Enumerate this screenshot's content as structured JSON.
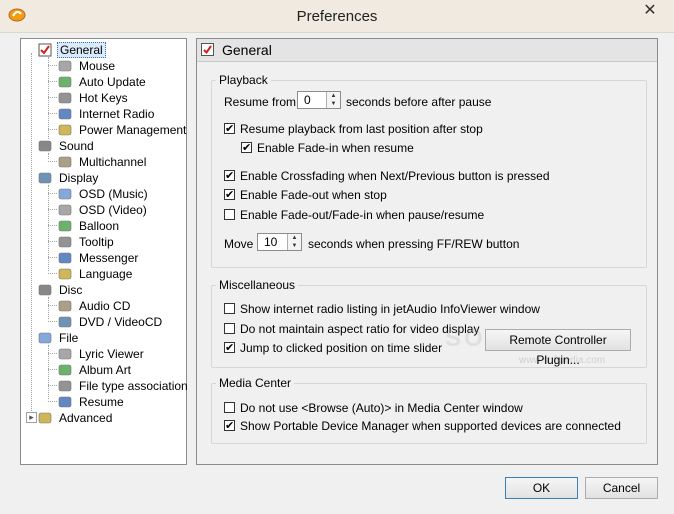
{
  "window": {
    "title": "Preferences",
    "close_symbol": "✕"
  },
  "tree": {
    "items": [
      {
        "label": "General",
        "level": 0,
        "icon": "general-check-icon",
        "selected": true
      },
      {
        "label": "Mouse",
        "level": 1,
        "icon": "mouse-icon"
      },
      {
        "label": "Auto Update",
        "level": 1,
        "icon": "update-icon"
      },
      {
        "label": "Hot Keys",
        "level": 1,
        "icon": "keyboard-icon"
      },
      {
        "label": "Internet Radio",
        "level": 1,
        "icon": "radio-icon"
      },
      {
        "label": "Power Management",
        "level": 1,
        "icon": "power-icon"
      },
      {
        "label": "Sound",
        "level": 0,
        "icon": "speaker-icon"
      },
      {
        "label": "Multichannel",
        "level": 1,
        "icon": "multichannel-icon"
      },
      {
        "label": "Display",
        "level": 0,
        "icon": "monitor-icon"
      },
      {
        "label": "OSD (Music)",
        "level": 1,
        "icon": "osd-music-icon"
      },
      {
        "label": "OSD (Video)",
        "level": 1,
        "icon": "osd-video-icon"
      },
      {
        "label": "Balloon",
        "level": 1,
        "icon": "balloon-icon"
      },
      {
        "label": "Tooltip",
        "level": 1,
        "icon": "tooltip-icon"
      },
      {
        "label": "Messenger",
        "level": 1,
        "icon": "messenger-icon"
      },
      {
        "label": "Language",
        "level": 1,
        "icon": "globe-icon"
      },
      {
        "label": "Disc",
        "level": 0,
        "icon": "disc-icon"
      },
      {
        "label": "Audio CD",
        "level": 1,
        "icon": "cd-icon"
      },
      {
        "label": "DVD / VideoCD",
        "level": 1,
        "icon": "dvd-icon"
      },
      {
        "label": "File",
        "level": 0,
        "icon": "file-icon"
      },
      {
        "label": "Lyric Viewer",
        "level": 1,
        "icon": "lyric-icon"
      },
      {
        "label": "Album Art",
        "level": 1,
        "icon": "album-art-icon"
      },
      {
        "label": "File type association",
        "level": 1,
        "icon": "file-type-icon"
      },
      {
        "label": "Resume",
        "level": 1,
        "icon": "resume-icon"
      },
      {
        "label": "Advanced",
        "level": 0,
        "icon": "advanced-icon",
        "collapsed": true
      }
    ]
  },
  "panel": {
    "title": "General",
    "playback": {
      "legend": "Playback",
      "resume_from_label": "Resume from",
      "resume_from_value": "0",
      "resume_from_suffix": "seconds before after pause",
      "resume_last_pos": {
        "label": "Resume playback from last position after stop",
        "checked": true
      },
      "fade_in_resume": {
        "label": "Enable Fade-in when resume",
        "checked": true
      },
      "crossfading": {
        "label": "Enable Crossfading when Next/Previous button is pressed",
        "checked": true
      },
      "fade_out_stop": {
        "label": "Enable Fade-out when stop",
        "checked": true
      },
      "fade_pause": {
        "label": "Enable Fade-out/Fade-in when pause/resume",
        "checked": false
      },
      "move_label": "Move",
      "move_value": "10",
      "move_suffix": "seconds when pressing FF/REW button"
    },
    "misc": {
      "legend": "Miscellaneous",
      "show_radio": {
        "label": "Show internet radio listing in jetAudio InfoViewer window",
        "checked": false
      },
      "no_aspect": {
        "label": "Do not maintain aspect ratio for video display",
        "checked": false
      },
      "jump_clicked": {
        "label": "Jump to clicked position on time slider",
        "checked": true
      },
      "remote_button": "Remote Controller Plugin..."
    },
    "media_center": {
      "legend": "Media Center",
      "no_browse": {
        "label": "Do not use <Browse (Auto)> in Media Center window",
        "checked": false
      },
      "show_pdm": {
        "label": "Show Portable Device Manager when supported devices are connected",
        "checked": true
      }
    }
  },
  "footer": {
    "ok": "OK",
    "cancel": "Cancel"
  },
  "watermark": {
    "main": "SOFTPEDIA",
    "sub": "www.softpedia.com"
  },
  "colors": {
    "selection_bg": "#dcebfc",
    "default_button_border": "#3c7fb1",
    "title_bar": "#f0eae0"
  }
}
